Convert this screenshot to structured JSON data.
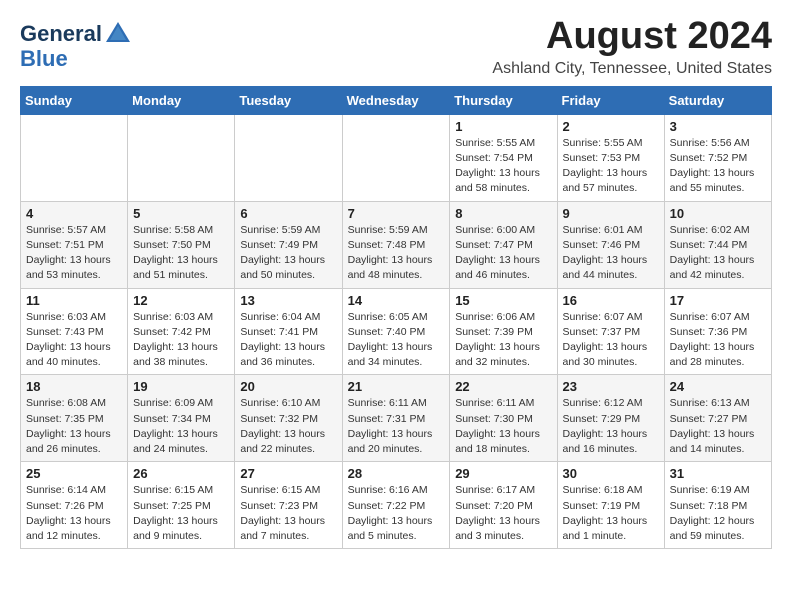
{
  "header": {
    "logo_general": "General",
    "logo_blue": "Blue",
    "month_year": "August 2024",
    "location": "Ashland City, Tennessee, United States"
  },
  "weekdays": [
    "Sunday",
    "Monday",
    "Tuesday",
    "Wednesday",
    "Thursday",
    "Friday",
    "Saturday"
  ],
  "weeks": [
    [
      {
        "day": "",
        "sunrise": "",
        "sunset": "",
        "daylight": ""
      },
      {
        "day": "",
        "sunrise": "",
        "sunset": "",
        "daylight": ""
      },
      {
        "day": "",
        "sunrise": "",
        "sunset": "",
        "daylight": ""
      },
      {
        "day": "",
        "sunrise": "",
        "sunset": "",
        "daylight": ""
      },
      {
        "day": "1",
        "sunrise": "Sunrise: 5:55 AM",
        "sunset": "Sunset: 7:54 PM",
        "daylight": "Daylight: 13 hours and 58 minutes."
      },
      {
        "day": "2",
        "sunrise": "Sunrise: 5:55 AM",
        "sunset": "Sunset: 7:53 PM",
        "daylight": "Daylight: 13 hours and 57 minutes."
      },
      {
        "day": "3",
        "sunrise": "Sunrise: 5:56 AM",
        "sunset": "Sunset: 7:52 PM",
        "daylight": "Daylight: 13 hours and 55 minutes."
      }
    ],
    [
      {
        "day": "4",
        "sunrise": "Sunrise: 5:57 AM",
        "sunset": "Sunset: 7:51 PM",
        "daylight": "Daylight: 13 hours and 53 minutes."
      },
      {
        "day": "5",
        "sunrise": "Sunrise: 5:58 AM",
        "sunset": "Sunset: 7:50 PM",
        "daylight": "Daylight: 13 hours and 51 minutes."
      },
      {
        "day": "6",
        "sunrise": "Sunrise: 5:59 AM",
        "sunset": "Sunset: 7:49 PM",
        "daylight": "Daylight: 13 hours and 50 minutes."
      },
      {
        "day": "7",
        "sunrise": "Sunrise: 5:59 AM",
        "sunset": "Sunset: 7:48 PM",
        "daylight": "Daylight: 13 hours and 48 minutes."
      },
      {
        "day": "8",
        "sunrise": "Sunrise: 6:00 AM",
        "sunset": "Sunset: 7:47 PM",
        "daylight": "Daylight: 13 hours and 46 minutes."
      },
      {
        "day": "9",
        "sunrise": "Sunrise: 6:01 AM",
        "sunset": "Sunset: 7:46 PM",
        "daylight": "Daylight: 13 hours and 44 minutes."
      },
      {
        "day": "10",
        "sunrise": "Sunrise: 6:02 AM",
        "sunset": "Sunset: 7:44 PM",
        "daylight": "Daylight: 13 hours and 42 minutes."
      }
    ],
    [
      {
        "day": "11",
        "sunrise": "Sunrise: 6:03 AM",
        "sunset": "Sunset: 7:43 PM",
        "daylight": "Daylight: 13 hours and 40 minutes."
      },
      {
        "day": "12",
        "sunrise": "Sunrise: 6:03 AM",
        "sunset": "Sunset: 7:42 PM",
        "daylight": "Daylight: 13 hours and 38 minutes."
      },
      {
        "day": "13",
        "sunrise": "Sunrise: 6:04 AM",
        "sunset": "Sunset: 7:41 PM",
        "daylight": "Daylight: 13 hours and 36 minutes."
      },
      {
        "day": "14",
        "sunrise": "Sunrise: 6:05 AM",
        "sunset": "Sunset: 7:40 PM",
        "daylight": "Daylight: 13 hours and 34 minutes."
      },
      {
        "day": "15",
        "sunrise": "Sunrise: 6:06 AM",
        "sunset": "Sunset: 7:39 PM",
        "daylight": "Daylight: 13 hours and 32 minutes."
      },
      {
        "day": "16",
        "sunrise": "Sunrise: 6:07 AM",
        "sunset": "Sunset: 7:37 PM",
        "daylight": "Daylight: 13 hours and 30 minutes."
      },
      {
        "day": "17",
        "sunrise": "Sunrise: 6:07 AM",
        "sunset": "Sunset: 7:36 PM",
        "daylight": "Daylight: 13 hours and 28 minutes."
      }
    ],
    [
      {
        "day": "18",
        "sunrise": "Sunrise: 6:08 AM",
        "sunset": "Sunset: 7:35 PM",
        "daylight": "Daylight: 13 hours and 26 minutes."
      },
      {
        "day": "19",
        "sunrise": "Sunrise: 6:09 AM",
        "sunset": "Sunset: 7:34 PM",
        "daylight": "Daylight: 13 hours and 24 minutes."
      },
      {
        "day": "20",
        "sunrise": "Sunrise: 6:10 AM",
        "sunset": "Sunset: 7:32 PM",
        "daylight": "Daylight: 13 hours and 22 minutes."
      },
      {
        "day": "21",
        "sunrise": "Sunrise: 6:11 AM",
        "sunset": "Sunset: 7:31 PM",
        "daylight": "Daylight: 13 hours and 20 minutes."
      },
      {
        "day": "22",
        "sunrise": "Sunrise: 6:11 AM",
        "sunset": "Sunset: 7:30 PM",
        "daylight": "Daylight: 13 hours and 18 minutes."
      },
      {
        "day": "23",
        "sunrise": "Sunrise: 6:12 AM",
        "sunset": "Sunset: 7:29 PM",
        "daylight": "Daylight: 13 hours and 16 minutes."
      },
      {
        "day": "24",
        "sunrise": "Sunrise: 6:13 AM",
        "sunset": "Sunset: 7:27 PM",
        "daylight": "Daylight: 13 hours and 14 minutes."
      }
    ],
    [
      {
        "day": "25",
        "sunrise": "Sunrise: 6:14 AM",
        "sunset": "Sunset: 7:26 PM",
        "daylight": "Daylight: 13 hours and 12 minutes."
      },
      {
        "day": "26",
        "sunrise": "Sunrise: 6:15 AM",
        "sunset": "Sunset: 7:25 PM",
        "daylight": "Daylight: 13 hours and 9 minutes."
      },
      {
        "day": "27",
        "sunrise": "Sunrise: 6:15 AM",
        "sunset": "Sunset: 7:23 PM",
        "daylight": "Daylight: 13 hours and 7 minutes."
      },
      {
        "day": "28",
        "sunrise": "Sunrise: 6:16 AM",
        "sunset": "Sunset: 7:22 PM",
        "daylight": "Daylight: 13 hours and 5 minutes."
      },
      {
        "day": "29",
        "sunrise": "Sunrise: 6:17 AM",
        "sunset": "Sunset: 7:20 PM",
        "daylight": "Daylight: 13 hours and 3 minutes."
      },
      {
        "day": "30",
        "sunrise": "Sunrise: 6:18 AM",
        "sunset": "Sunset: 7:19 PM",
        "daylight": "Daylight: 13 hours and 1 minute."
      },
      {
        "day": "31",
        "sunrise": "Sunrise: 6:19 AM",
        "sunset": "Sunset: 7:18 PM",
        "daylight": "Daylight: 12 hours and 59 minutes."
      }
    ]
  ]
}
